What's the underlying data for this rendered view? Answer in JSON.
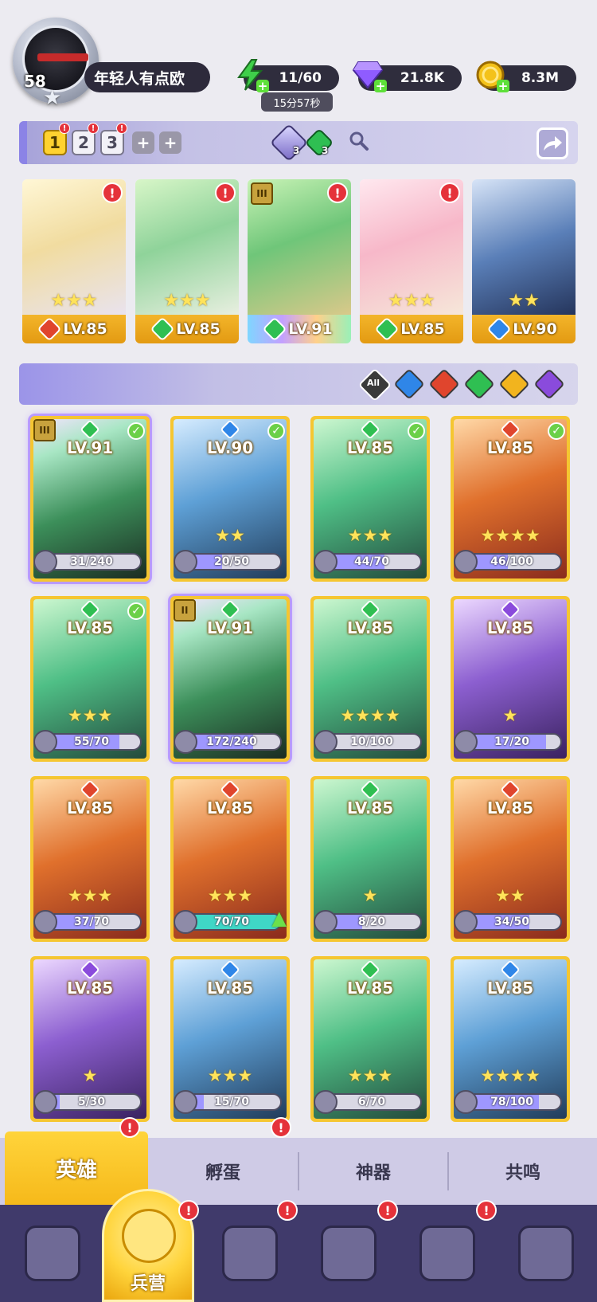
{
  "player": {
    "level": "58",
    "name": "年轻人有点欧"
  },
  "resources": {
    "energy": {
      "value": "11/60",
      "timer": "15分57秒",
      "icon": "lightning-icon",
      "color": "#3fcf4a"
    },
    "gems": {
      "value": "21.8K",
      "icon": "diamond-icon",
      "color": "#8f5cff"
    },
    "gold": {
      "value": "8.3M",
      "icon": "coin-icon",
      "color": "#f4c21a"
    }
  },
  "team_tabs": [
    "1",
    "2",
    "3"
  ],
  "team_add_icons": [
    "plus-icon",
    "plus-icon"
  ],
  "team_gems": {
    "purple": "3",
    "green": "3"
  },
  "team": [
    {
      "level": "LV.85",
      "element": "fire",
      "stars": "★★★",
      "alert": "!"
    },
    {
      "level": "LV.85",
      "element": "nature",
      "stars": "★★★",
      "alert": "!"
    },
    {
      "level": "LV.91",
      "element": "nature",
      "stars": "",
      "alert": "!",
      "rank": "III"
    },
    {
      "level": "LV.85",
      "element": "nature",
      "stars": "★★★",
      "alert": "!"
    },
    {
      "level": "LV.90",
      "element": "water",
      "stars": "★★",
      "alert": ""
    }
  ],
  "filters": {
    "all_label": "All",
    "elements": [
      "water",
      "fire",
      "nature",
      "light",
      "dark"
    ]
  },
  "element_colors": {
    "fire": "#e0452d",
    "nature": "#2fbf52",
    "water": "#2f86e8",
    "light": "#f2b41e",
    "dark": "#8a4bdc"
  },
  "heroes": [
    {
      "level": "LV.91",
      "element": "nature",
      "shards": "31/240",
      "progress": 0.13,
      "stars": "",
      "checked": true,
      "rank": "III",
      "highlight": true
    },
    {
      "level": "LV.90",
      "element": "water",
      "shards": "20/50",
      "progress": 0.4,
      "stars": "★★",
      "checked": true
    },
    {
      "level": "LV.85",
      "element": "nature",
      "shards": "44/70",
      "progress": 0.63,
      "stars": "★★★",
      "checked": true
    },
    {
      "level": "LV.85",
      "element": "fire",
      "shards": "46/100",
      "progress": 0.46,
      "stars": "★★★★",
      "checked": true
    },
    {
      "level": "LV.85",
      "element": "nature",
      "shards": "55/70",
      "progress": 0.79,
      "stars": "★★★",
      "checked": true
    },
    {
      "level": "LV.91",
      "element": "nature",
      "shards": "172/240",
      "progress": 0.72,
      "stars": "",
      "checked": false,
      "rank": "II",
      "highlight": true
    },
    {
      "level": "LV.85",
      "element": "nature",
      "shards": "10/100",
      "progress": 0.1,
      "stars": "★★★★",
      "checked": false
    },
    {
      "level": "LV.85",
      "element": "dark",
      "shards": "17/20",
      "progress": 0.85,
      "stars": "★",
      "checked": false
    },
    {
      "level": "LV.85",
      "element": "fire",
      "shards": "37/70",
      "progress": 0.53,
      "stars": "★★★",
      "checked": false
    },
    {
      "level": "LV.85",
      "element": "fire",
      "shards": "70/70",
      "progress": 1.0,
      "stars": "★★★",
      "checked": false,
      "upgrade": true
    },
    {
      "level": "LV.85",
      "element": "nature",
      "shards": "8/20",
      "progress": 0.4,
      "stars": "★",
      "checked": false
    },
    {
      "level": "LV.85",
      "element": "fire",
      "shards": "34/50",
      "progress": 0.68,
      "stars": "★★",
      "checked": false
    },
    {
      "level": "LV.85",
      "element": "dark",
      "shards": "5/30",
      "progress": 0.17,
      "stars": "★",
      "checked": false
    },
    {
      "level": "LV.85",
      "element": "water",
      "shards": "15/70",
      "progress": 0.21,
      "stars": "★★★",
      "checked": false
    },
    {
      "level": "LV.85",
      "element": "nature",
      "shards": "6/70",
      "progress": 0.09,
      "stars": "★★★",
      "checked": false
    },
    {
      "level": "LV.85",
      "element": "water",
      "shards": "78/100",
      "progress": 0.78,
      "stars": "★★★★",
      "checked": false
    }
  ],
  "sub_tabs": [
    {
      "label": "英雄",
      "active": true,
      "alert": "!"
    },
    {
      "label": "孵蛋",
      "active": false,
      "alert": "!"
    },
    {
      "label": "神器",
      "active": false,
      "alert": ""
    },
    {
      "label": "共鸣",
      "active": false,
      "alert": ""
    }
  ],
  "bottom_nav": [
    {
      "icon": "cards-icon",
      "label": "",
      "alert": ""
    },
    {
      "icon": "barracks-icon",
      "label": "兵营",
      "alert": "!",
      "active": true
    },
    {
      "icon": "map-book-icon",
      "label": "",
      "alert": "!"
    },
    {
      "icon": "castle-icon",
      "label": "",
      "alert": "!"
    },
    {
      "icon": "mushroom-house-icon",
      "label": "",
      "alert": "!"
    },
    {
      "icon": "guild-banner-icon",
      "label": "",
      "alert": ""
    }
  ]
}
